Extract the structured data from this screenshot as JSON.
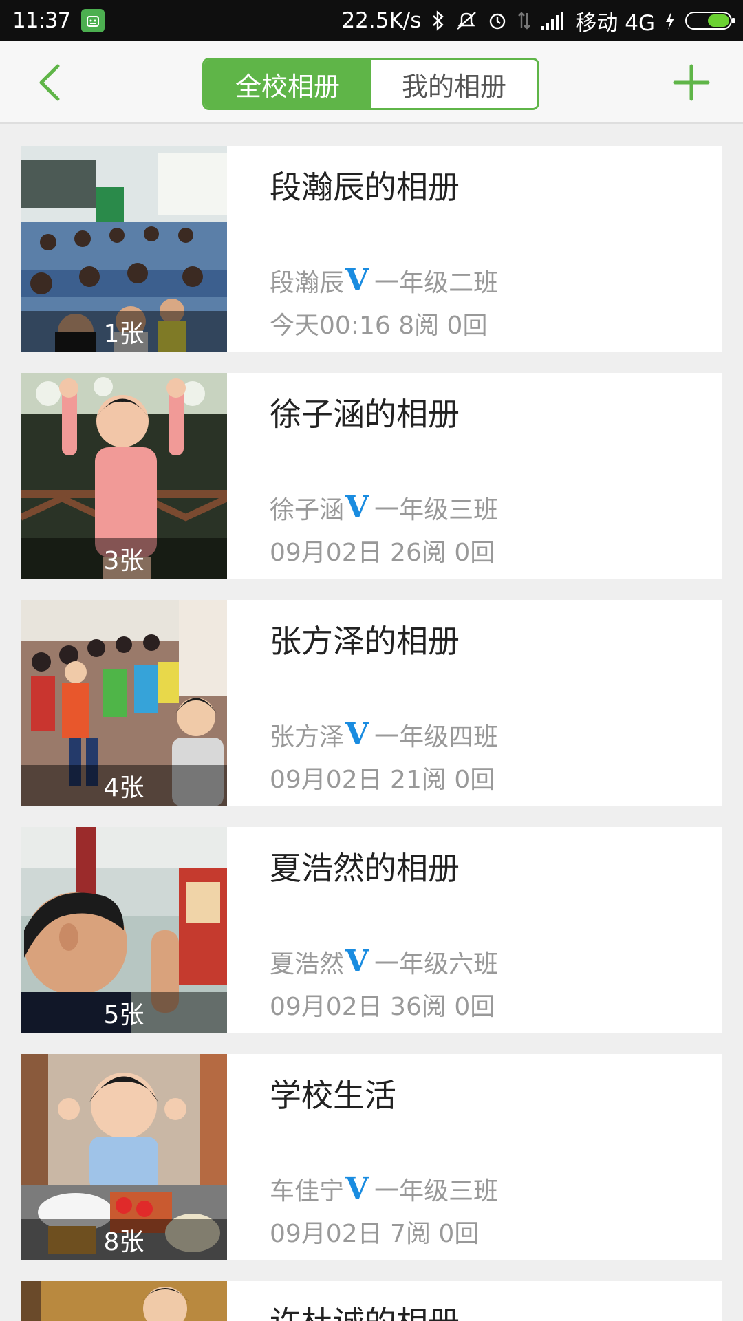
{
  "status_bar": {
    "time": "11:37",
    "network_speed": "22.5K/s",
    "carrier": "移动 4G",
    "icons": [
      "app-notification-icon",
      "bluetooth-icon",
      "mute-icon",
      "alarm-icon",
      "data-transfer-icon",
      "signal-icon",
      "charging-icon",
      "battery-icon"
    ]
  },
  "navbar": {
    "back_icon": "chevron-left-icon",
    "add_icon": "plus-icon",
    "tabs": [
      {
        "label": "全校相册",
        "active": true
      },
      {
        "label": "我的相册",
        "active": false
      }
    ],
    "accent_color": "#5fb548"
  },
  "albums": [
    {
      "title": "段瀚辰的相册",
      "author": "段瀚辰",
      "verified_badge": "V",
      "class_name": "一年级二班",
      "stats": "今天00:16 8阅 0回",
      "photo_count": "1张"
    },
    {
      "title": "徐子涵的相册",
      "author": "徐子涵",
      "verified_badge": "V",
      "class_name": "一年级三班",
      "stats": "09月02日 26阅 0回",
      "photo_count": "3张"
    },
    {
      "title": "张方泽的相册",
      "author": "张方泽",
      "verified_badge": "V",
      "class_name": "一年级四班",
      "stats": "09月02日 21阅 0回",
      "photo_count": "4张"
    },
    {
      "title": "夏浩然的相册",
      "author": "夏浩然",
      "verified_badge": "V",
      "class_name": "一年级六班",
      "stats": "09月02日 36阅 0回",
      "photo_count": "5张"
    },
    {
      "title": "学校生活",
      "author": "车佳宁",
      "verified_badge": "V",
      "class_name": "一年级三班",
      "stats": "09月02日 7阅 0回",
      "photo_count": "8张"
    },
    {
      "title": "许杜诚的相册",
      "author": "",
      "verified_badge": "",
      "class_name": "",
      "stats": "",
      "photo_count": ""
    }
  ],
  "badge_color": "#1a8ce0"
}
